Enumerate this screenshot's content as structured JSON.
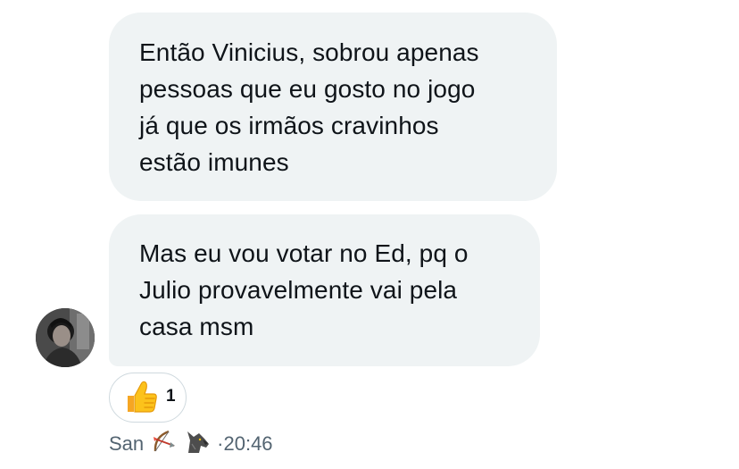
{
  "conversation": {
    "messages": [
      {
        "text": "Então Vinicius, sobrou apenas\npessoas que eu gosto no jogo\njá que os irmãos cravinhos\nestão imunes"
      },
      {
        "text": "Mas eu vou votar no Ed, pq o\nJulio provavelmente vai pela\ncasa msm"
      }
    ],
    "reaction": {
      "emoji_icon": "thumbs-up-icon",
      "count": "1"
    },
    "meta": {
      "sender_name": "San",
      "name_icons": [
        "bow-and-arrow-icon",
        "wolf-icon"
      ],
      "separator": "·",
      "time": "20:46"
    }
  }
}
